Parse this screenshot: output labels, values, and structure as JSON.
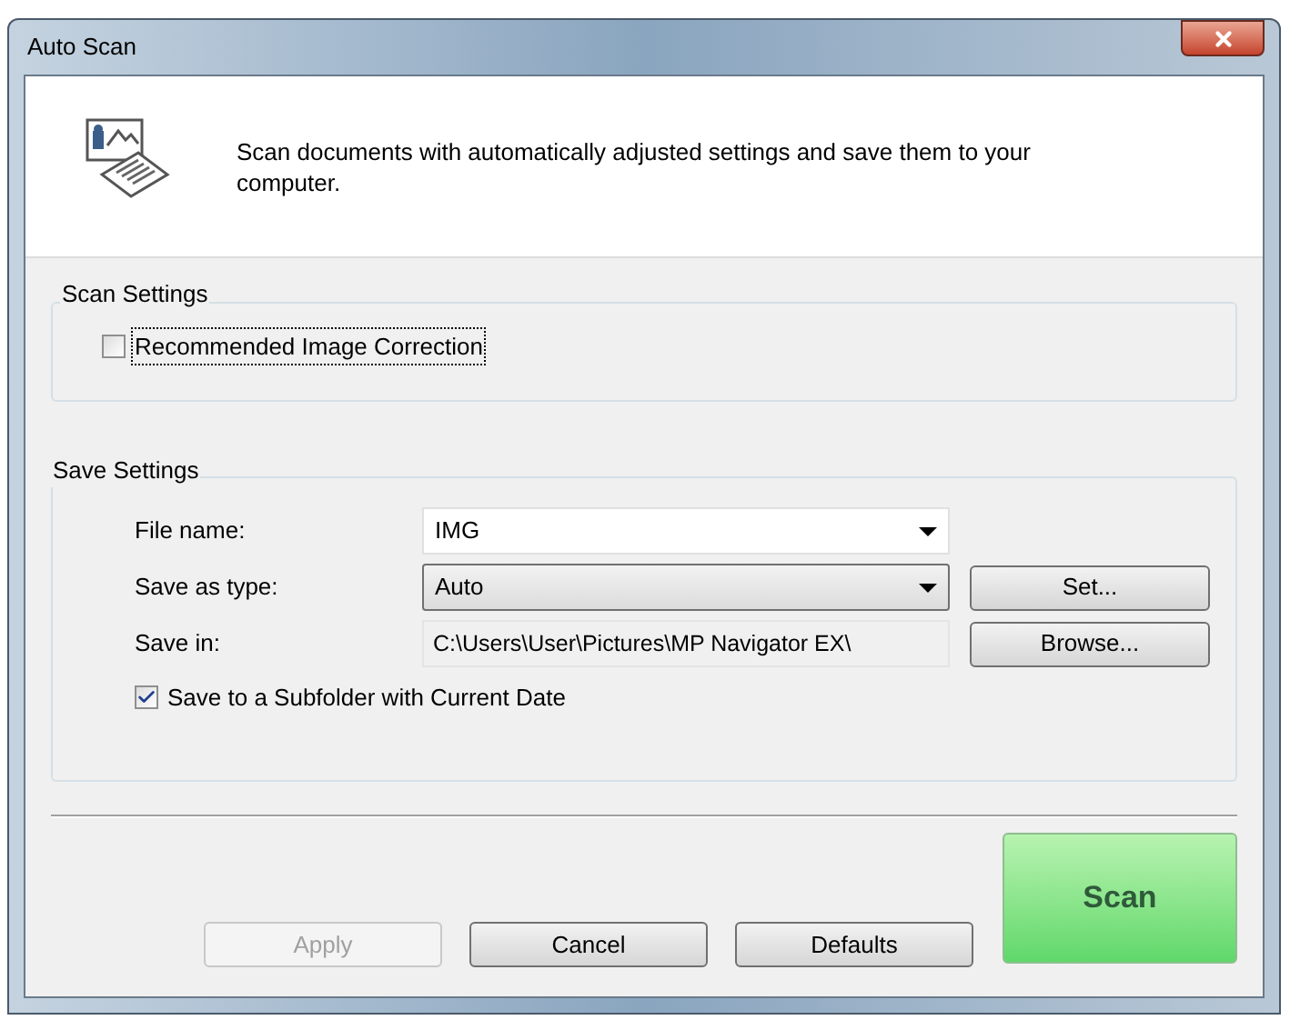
{
  "window": {
    "title": "Auto Scan"
  },
  "header": {
    "description": "Scan documents with automatically adjusted settings and save them to your computer."
  },
  "scan_settings": {
    "title": "Scan Settings",
    "checkbox": {
      "label": "Recommended Image Correction",
      "checked": false,
      "focused": true
    }
  },
  "save_settings": {
    "title": "Save Settings",
    "fields": [
      {
        "kind": "combo",
        "label": "File name:",
        "value": "IMG"
      },
      {
        "kind": "dropdown",
        "label": "Save as type:",
        "value": "Auto",
        "button": "Set..."
      },
      {
        "kind": "path",
        "label": "Save in:",
        "value": "C:\\Users\\User\\Pictures\\MP Navigator EX\\",
        "button": "Browse..."
      }
    ],
    "checkbox": {
      "label": "Save to a Subfolder with Current Date",
      "checked": true,
      "focused": false
    }
  },
  "buttons": [
    {
      "label": "Apply",
      "disabled": true
    },
    {
      "label": "Cancel",
      "disabled": false
    },
    {
      "label": "Defaults",
      "disabled": false
    }
  ],
  "scan_button": {
    "label": "Scan"
  }
}
